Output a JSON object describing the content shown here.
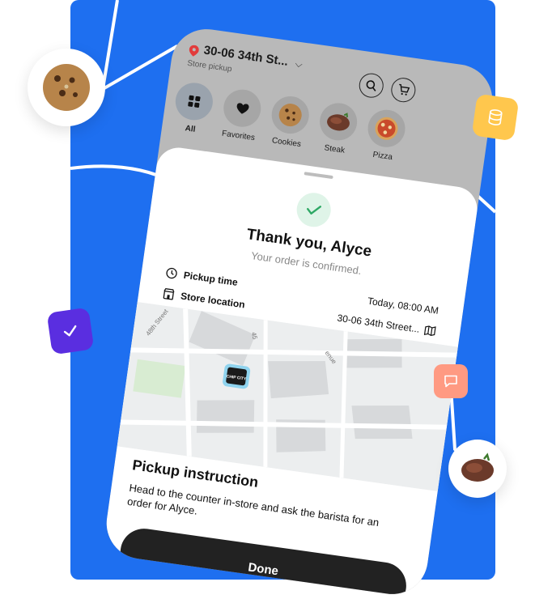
{
  "colors": {
    "stage_bg": "#1e6ff0",
    "accent_yellow": "#ffc74d",
    "accent_purple": "#5a2ee0",
    "accent_salmon": "#ff9a82",
    "success": "#2ea865",
    "button_dark": "#222222"
  },
  "header": {
    "location_title": "30-06 34th St...",
    "location_subtitle": "Store pickup",
    "icons": {
      "pin": "location-pin-icon",
      "search": "search-icon",
      "cart": "cart-icon"
    }
  },
  "categories": [
    {
      "label": "All",
      "icon": "grid-icon",
      "active": true
    },
    {
      "label": "Favorites",
      "icon": "heart-icon",
      "active": false
    },
    {
      "label": "Cookies",
      "icon": "cookie-icon",
      "active": false
    },
    {
      "label": "Steak",
      "icon": "steak-icon",
      "active": false
    },
    {
      "label": "Pizza",
      "icon": "pizza-icon",
      "active": false
    }
  ],
  "confirmation": {
    "title": "Thank you, Alyce",
    "subtitle": "Your order is confirmed.",
    "pickup_time_label": "Pickup time",
    "pickup_time_value": "Today, 08:00 AM",
    "store_location_label": "Store location",
    "store_location_value": "30-06 34th Street..."
  },
  "map": {
    "streets": [
      "48th Street",
      "45",
      "enue"
    ],
    "store_logo_text": "CHIP CITY"
  },
  "instruction": {
    "title": "Pickup instruction",
    "text": "Head to the counter in-store and ask the barista for an order for Alyce."
  },
  "actions": {
    "done_label": "Done"
  }
}
